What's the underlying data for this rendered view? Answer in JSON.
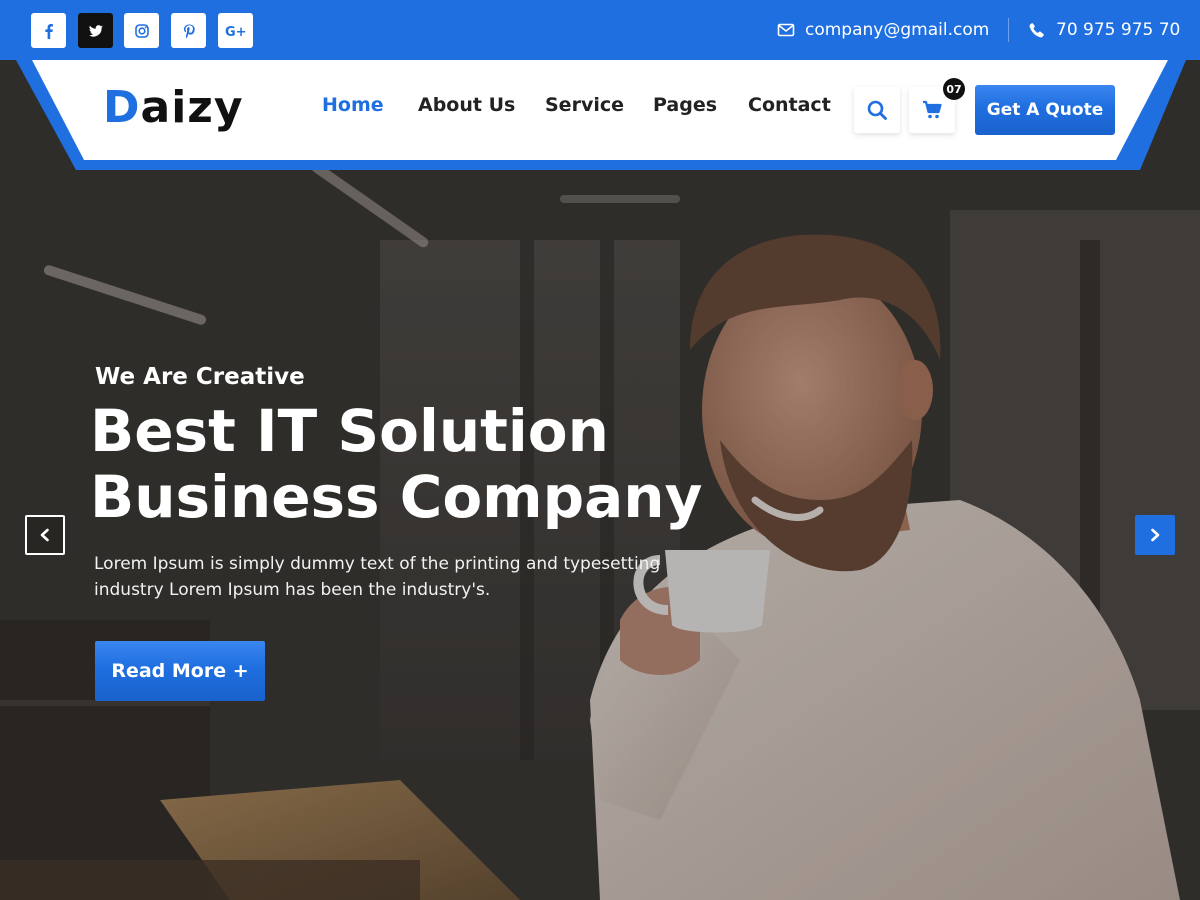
{
  "topbar": {
    "social": [
      {
        "icon": "facebook-icon"
      },
      {
        "icon": "twitter-icon"
      },
      {
        "icon": "instagram-icon"
      },
      {
        "icon": "pinterest-icon"
      },
      {
        "icon": "google-plus-icon",
        "label": "G+"
      }
    ],
    "email": "company@gmail.com",
    "phone": "70 975 975 70"
  },
  "header": {
    "logo_first": "D",
    "logo_rest": "aizy",
    "menu": [
      "Home",
      "About Us",
      "Service",
      "Pages",
      "Contact"
    ],
    "active_menu": "Home",
    "cart_count": "07",
    "quote_label": "Get A Quote"
  },
  "hero": {
    "eyebrow": "We Are Creative",
    "headline_line1": "Best IT Solution",
    "headline_line2": "Business Company",
    "description": "Lorem Ipsum is simply dummy text of the printing and typesetting industry Lorem Ipsum has been the industry's.",
    "cta_label": "Read More +"
  },
  "colors": {
    "accent": "#1f6fe0",
    "dark": "#111111",
    "white": "#ffffff"
  }
}
